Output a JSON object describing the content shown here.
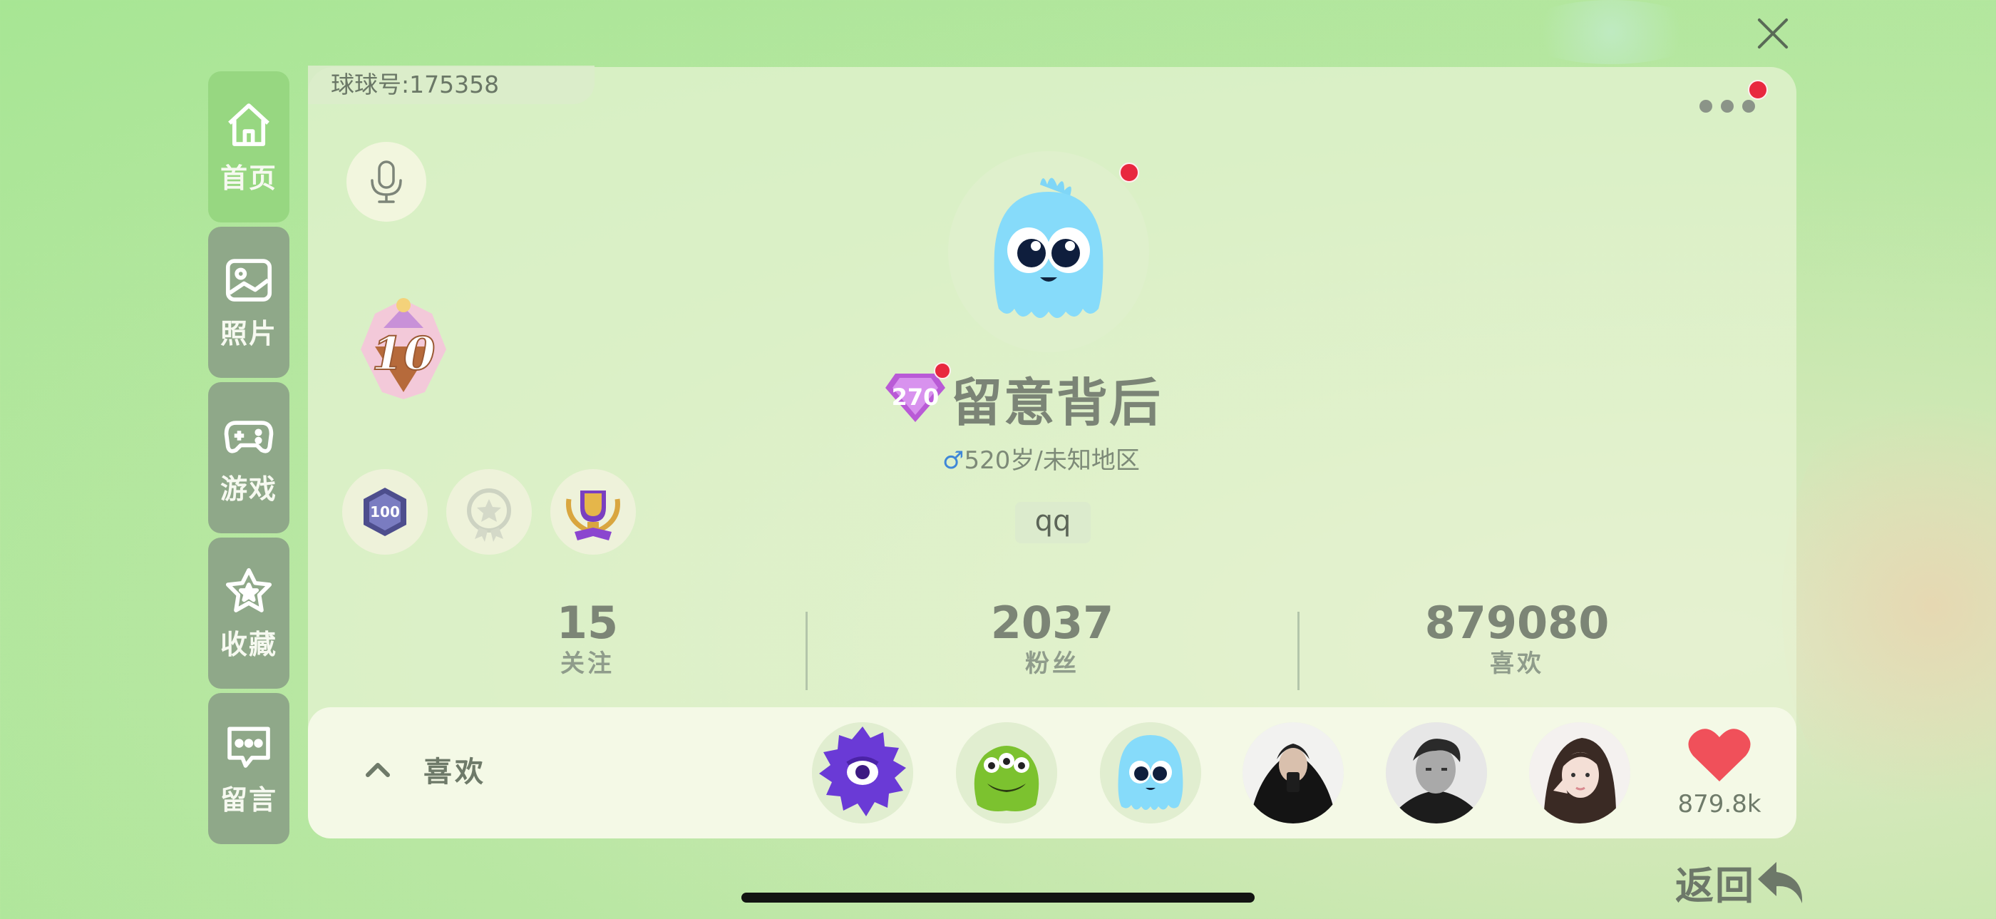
{
  "header": {
    "id_label": "球球号:175358"
  },
  "sidebar": {
    "items": [
      {
        "label": "首页",
        "icon": "home-icon",
        "active": true
      },
      {
        "label": "照片",
        "icon": "photo-icon",
        "active": false
      },
      {
        "label": "游戏",
        "icon": "gamepad-icon",
        "active": false
      },
      {
        "label": "收藏",
        "icon": "star-icon",
        "active": false
      },
      {
        "label": "留言",
        "icon": "message-icon",
        "active": false
      }
    ]
  },
  "profile": {
    "level_badge": "10",
    "gem_level": "270",
    "nickname": "留意背后",
    "gender_symbol": "♂",
    "age_region": "520岁/未知地区",
    "signature": "qq",
    "medals": [
      "100",
      "star",
      "trophy"
    ]
  },
  "stats": [
    {
      "value": "15",
      "label": "关注"
    },
    {
      "value": "2037",
      "label": "粉丝"
    },
    {
      "value": "879080",
      "label": "喜欢"
    }
  ],
  "likes": {
    "title": "喜欢",
    "count": "879.8k",
    "avatars": [
      "purple-monster",
      "green-monster",
      "blue-ghost",
      "person-1",
      "person-2",
      "person-3"
    ]
  },
  "footer": {
    "back_label": "返回"
  },
  "colors": {
    "accent_green": "#97d781",
    "sidebar_gray": "#8fa889",
    "notify_red": "#e8283f",
    "heart_red": "#f0505a"
  }
}
